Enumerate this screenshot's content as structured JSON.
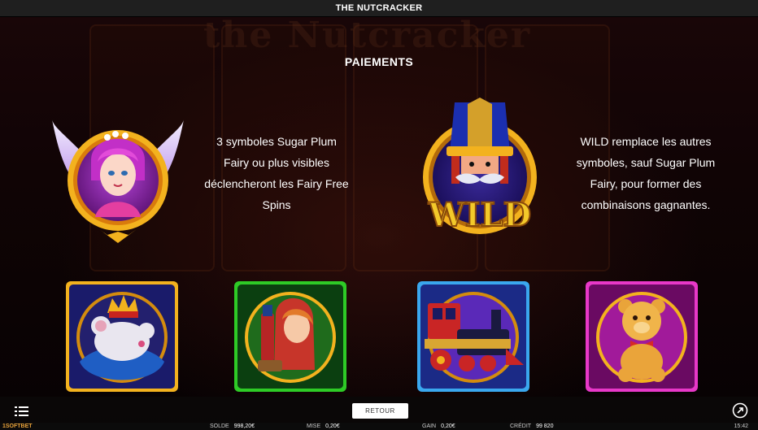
{
  "app": {
    "title": "THE NUTCRACKER",
    "background_logo": "the Nutcracker"
  },
  "paytable": {
    "heading": "PAIEMENTS",
    "features": [
      {
        "icon": "sugar-plum-fairy-icon",
        "text": [
          "3 symboles Sugar Plum",
          "Fairy ou plus visibles",
          "déclencheront les Fairy Free",
          "Spins"
        ]
      },
      {
        "icon": "wild-nutcracker-icon",
        "badge": "WILD",
        "text": [
          "WILD remplace les autres",
          "symboles, sauf Sugar Plum",
          "Fairy, pour former des",
          "combinaisons gagnantes."
        ]
      }
    ],
    "symbols": [
      "mouse-king-icon",
      "clara-nutcracker-icon",
      "toy-train-icon",
      "teddy-bear-icon"
    ]
  },
  "bottom": {
    "return_label": "RETOUR",
    "menu_icon": "menu-icon",
    "exit_icon": "exit-icon"
  },
  "status": {
    "brand": "1SOFTBET",
    "solde_label": "SOLDE",
    "solde_value": "998,20€",
    "mise_label": "MISE",
    "mise_value": "0,20€",
    "gain_label": "GAIN",
    "gain_value": "0,20€",
    "credit_label": "CRÉDIT",
    "credit_value": "99 820",
    "time": "15:42"
  },
  "colors": {
    "topbar": "#1f1f1f",
    "gold": "#f3b21e",
    "brand": "#e9a33a"
  }
}
